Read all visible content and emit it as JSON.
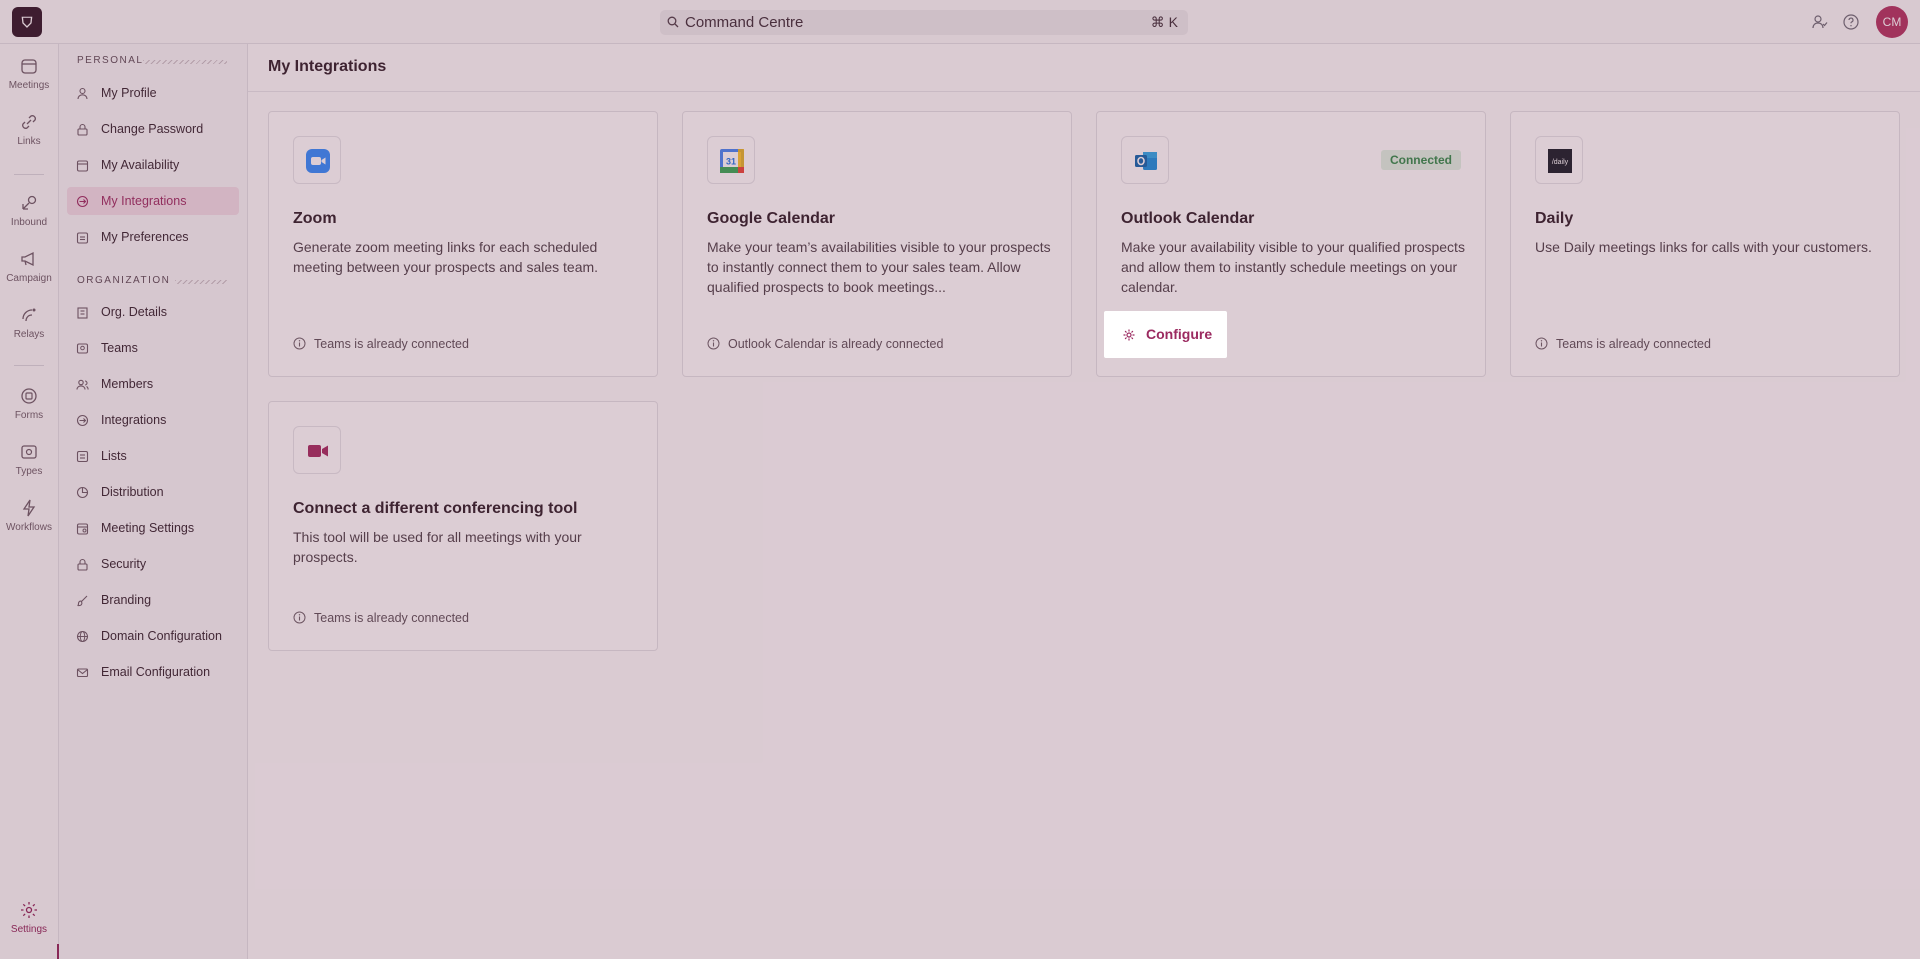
{
  "app": {
    "search_text": "Command Centre",
    "search_shortcut": "⌘ K",
    "avatar_initials": "CM",
    "brand_color": "#8e1f55"
  },
  "rail": {
    "items": [
      {
        "label": "Meetings",
        "icon": "calendar-icon"
      },
      {
        "label": "Links",
        "icon": "link-icon"
      },
      {
        "label": "Inbound",
        "icon": "inbound-icon"
      },
      {
        "label": "Campaign",
        "icon": "megaphone-icon"
      },
      {
        "label": "Relays",
        "icon": "relay-icon"
      },
      {
        "label": "Forms",
        "icon": "form-icon"
      },
      {
        "label": "Types",
        "icon": "types-icon"
      },
      {
        "label": "Workflows",
        "icon": "bolt-icon"
      },
      {
        "label": "Settings",
        "icon": "gear-icon"
      }
    ]
  },
  "sidebar": {
    "personal_label": "PERSONAL",
    "organization_label": "ORGANIZATION",
    "personal_items": [
      {
        "label": "My Profile",
        "icon": "user-icon"
      },
      {
        "label": "Change Password",
        "icon": "lock-icon"
      },
      {
        "label": "My Availability",
        "icon": "calendar-icon"
      },
      {
        "label": "My Integrations",
        "icon": "integrations-icon",
        "active": true
      },
      {
        "label": "My Preferences",
        "icon": "preferences-icon"
      }
    ],
    "org_items": [
      {
        "label": "Org. Details",
        "icon": "building-icon"
      },
      {
        "label": "Teams",
        "icon": "teams-icon"
      },
      {
        "label": "Members",
        "icon": "members-icon"
      },
      {
        "label": "Integrations",
        "icon": "integrations-icon"
      },
      {
        "label": "Lists",
        "icon": "list-icon"
      },
      {
        "label": "Distribution",
        "icon": "distribution-icon"
      },
      {
        "label": "Meeting Settings",
        "icon": "meeting-settings-icon"
      },
      {
        "label": "Security",
        "icon": "lock-icon"
      },
      {
        "label": "Branding",
        "icon": "brush-icon"
      },
      {
        "label": "Domain Configuration",
        "icon": "globe-icon"
      },
      {
        "label": "Email Configuration",
        "icon": "mail-icon"
      }
    ]
  },
  "main": {
    "title": "My Integrations",
    "cards": [
      {
        "name": "Zoom",
        "description": "Generate zoom meeting links for each scheduled meeting between your prospects and sales team.",
        "status": "Teams is already connected",
        "icon": "zoom-icon"
      },
      {
        "name": "Google Calendar",
        "description": "Make your team’s availabilities visible to your prospects to instantly connect them to your sales team. Allow qualified prospects to book meetings...",
        "status": "Outlook Calendar is already connected",
        "icon": "google-calendar-icon",
        "icon_text": "31"
      },
      {
        "name": "Outlook Calendar",
        "description": "Make your availability visible to your qualified prospects and allow them to instantly schedule meetings on your calendar.",
        "badge": "Connected",
        "action": "Configure",
        "icon": "outlook-icon"
      },
      {
        "name": "Daily",
        "description": "Use Daily meetings links for calls with your customers.",
        "status": "Teams is already connected",
        "icon": "daily-icon",
        "icon_text": "/daily"
      },
      {
        "name": "Connect a different conferencing tool",
        "description": "This tool will be used for all meetings with your prospects.",
        "status": "Teams is already connected",
        "icon": "video-camera-icon"
      }
    ]
  }
}
